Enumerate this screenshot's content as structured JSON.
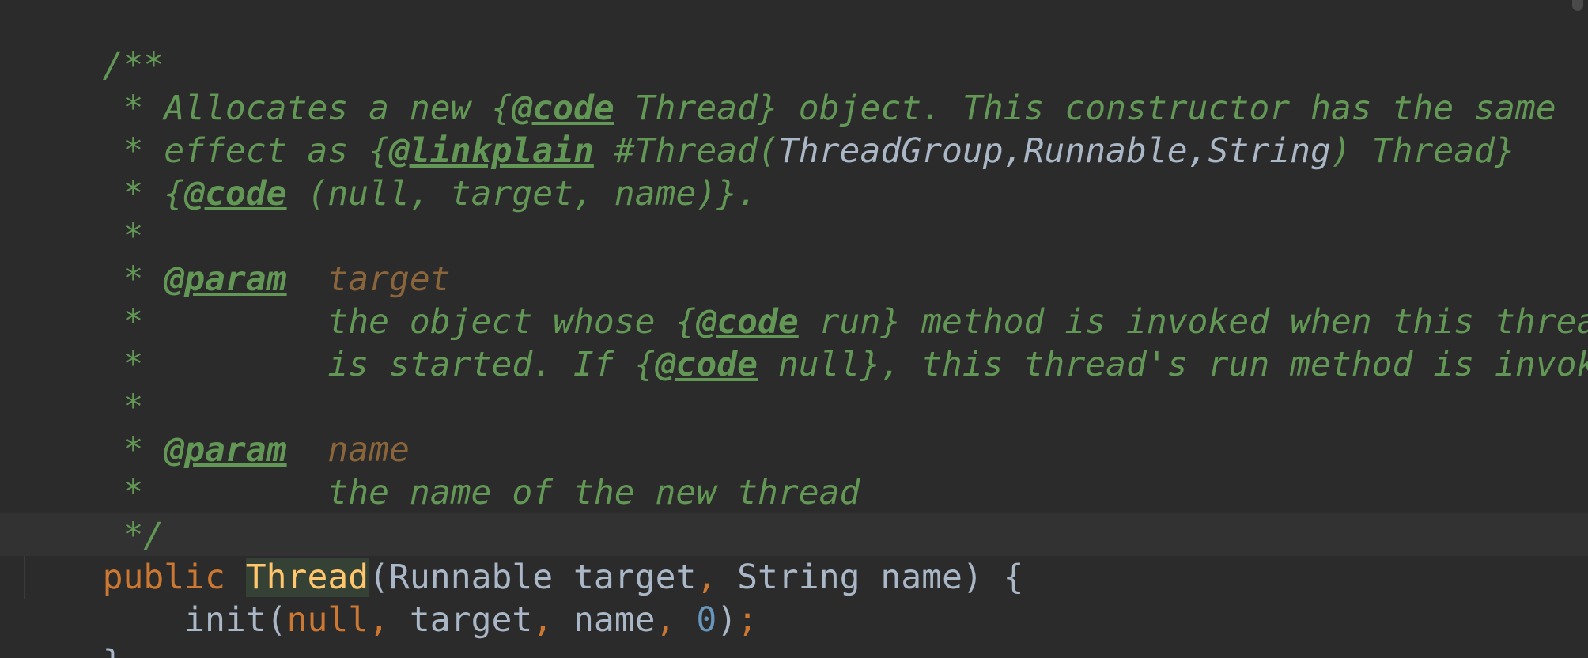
{
  "editor": {
    "theme_colors": {
      "background": "#2b2b2b",
      "doc_comment": "#629755",
      "doc_param": "#8a653b",
      "keyword": "#cc7832",
      "number": "#6897bb",
      "method_declaration": "#ffc66d",
      "default_text": "#a9b7c6"
    }
  },
  "code": {
    "l1": {
      "a": "/**"
    },
    "l2": {
      "a": " * Allocates a new {",
      "tag": "@code",
      "b": " Thread} object. This constructor has the same"
    },
    "l3": {
      "a": " * effect as {",
      "tag": "@linkplain",
      "b": " #Thread(",
      "ref": "ThreadGroup,Runnable,String",
      "c": ") Thread}"
    },
    "l4": {
      "a": " * {",
      "tag": "@code",
      "b": " (null, target, name)}."
    },
    "l5": {
      "a": " *"
    },
    "l6": {
      "a": " * ",
      "tag": "@param",
      "b": "  ",
      "param": "target"
    },
    "l7": {
      "a": " *         the object whose {",
      "tag": "@code",
      "b": " run} method is invoked when this thread"
    },
    "l8": {
      "a": " *         is started. If {",
      "tag": "@code",
      "b": " null}, this thread's run method is invoked."
    },
    "l9": {
      "a": " *"
    },
    "l10": {
      "a": " * ",
      "tag": "@param",
      "b": "  ",
      "param": "name"
    },
    "l11": {
      "a": " *         the name of the new thread"
    },
    "l12": {
      "a": " */"
    },
    "l13": {
      "kw": "public",
      "sp": " ",
      "method": "Thread",
      "a": "(Runnable target",
      "comma1": ",",
      "b": " String name) {"
    },
    "l14": {
      "indent": "    init(",
      "kw": "null",
      "comma1": ",",
      "a": " target",
      "comma2": ",",
      "b": " name",
      "comma3": ",",
      "sp": " ",
      "num": "0",
      "c": ")",
      "semi": ";"
    },
    "l15": {
      "a": "}"
    }
  }
}
